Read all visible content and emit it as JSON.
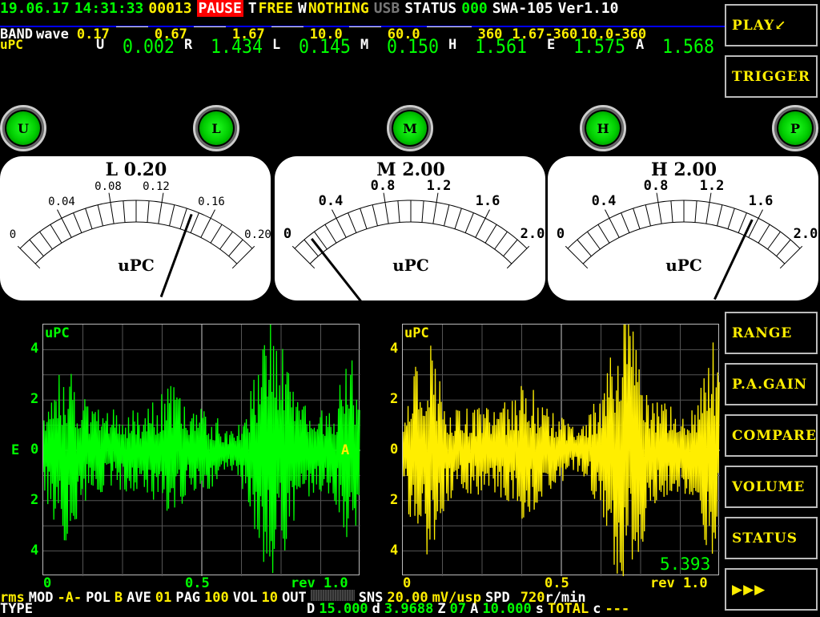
{
  "status_bar": {
    "date": "19.06.17",
    "time": "14:31:33",
    "counter": "00013",
    "mode": "PAUSE",
    "t_label": "T",
    "t_value": "FREE",
    "w_label": "W",
    "w_value": "NOTHING",
    "usb": "USB",
    "status_label": "STATUS",
    "status_value": "000",
    "model": "SWA-105",
    "version": "Ver1.10"
  },
  "band": {
    "label": "BAND",
    "type": "wave",
    "bands": [
      "0.17",
      "0.67",
      "1.67",
      "10.0",
      "60.0",
      "360"
    ],
    "extra": [
      "1.67-360",
      "10.0-360"
    ]
  },
  "readings": {
    "unit": "uPC",
    "items": [
      {
        "k": "U",
        "v": "0.002"
      },
      {
        "k": "R",
        "v": "1.434"
      },
      {
        "k": "L",
        "v": "0.145"
      },
      {
        "k": "M",
        "v": "0.150"
      },
      {
        "k": "H",
        "v": "1.561"
      },
      {
        "k": "E",
        "v": "1.575"
      },
      {
        "k": "A",
        "v": "1.568"
      }
    ]
  },
  "leds": [
    "U",
    "L",
    "M",
    "H",
    "P"
  ],
  "gauges": [
    {
      "title": "L 0.20",
      "unit": "uPC",
      "max": 0.2,
      "value": 0.145,
      "ticks": [
        "0",
        "0.04",
        "0.08",
        "0.12",
        "0.16",
        "0.20"
      ]
    },
    {
      "title": "M 2.00",
      "unit": "uPC",
      "max": 2.0,
      "value": 0.15,
      "ticks": [
        "0",
        "0.4",
        "0.8",
        "1.2",
        "1.6",
        "2.0"
      ]
    },
    {
      "title": "H 2.00",
      "unit": "uPC",
      "max": 2.0,
      "value": 1.561,
      "ticks": [
        "0",
        "0.4",
        "0.8",
        "1.2",
        "1.6",
        "2.0"
      ]
    }
  ],
  "plots": [
    {
      "channel": "E",
      "unit": "uPC",
      "color": "#00ff00",
      "y_ticks": [
        "4",
        "2",
        "0",
        "2",
        "4"
      ],
      "x_ticks": [
        "0",
        "0.5",
        "rev 1.0"
      ],
      "readout": ""
    },
    {
      "channel": "A",
      "unit": "uPC",
      "color": "#ffee00",
      "y_ticks": [
        "4",
        "2",
        "0",
        "2",
        "4"
      ],
      "x_ticks": [
        "0",
        "0.5",
        "rev 1.0"
      ],
      "readout": "5.393"
    }
  ],
  "side_buttons": [
    "PLAY↙",
    "TRIGGER",
    "RANGE",
    "P.A.GAIN",
    "COMPARE",
    "VOLUME",
    "STATUS",
    "▶▶▶"
  ],
  "footer": {
    "rms": "rms",
    "mod_label": "MOD",
    "mod": "-A-",
    "pol_label": "POL",
    "pol": "B",
    "ave_label": "AVE",
    "ave": "01",
    "pag_label": "PAG",
    "pag": "100",
    "vol_label": "VOL",
    "vol": "10",
    "out_label": "OUT",
    "sns_label": "SNS",
    "sns": "20.00",
    "sns_unit": "mV/usp",
    "spd_label": "SPD",
    "spd": "720",
    "spd_unit": "r/min",
    "type_label": "TYPE",
    "d_label": "D",
    "d": "15.000",
    "dd_label": "d",
    "dd": "3.9688",
    "z_label": "Z",
    "z": "07",
    "a_label": "A",
    "a": "10.000",
    "s_label": "s",
    "total_label": "TOTAL",
    "c_label": "c",
    "c": "---"
  }
}
